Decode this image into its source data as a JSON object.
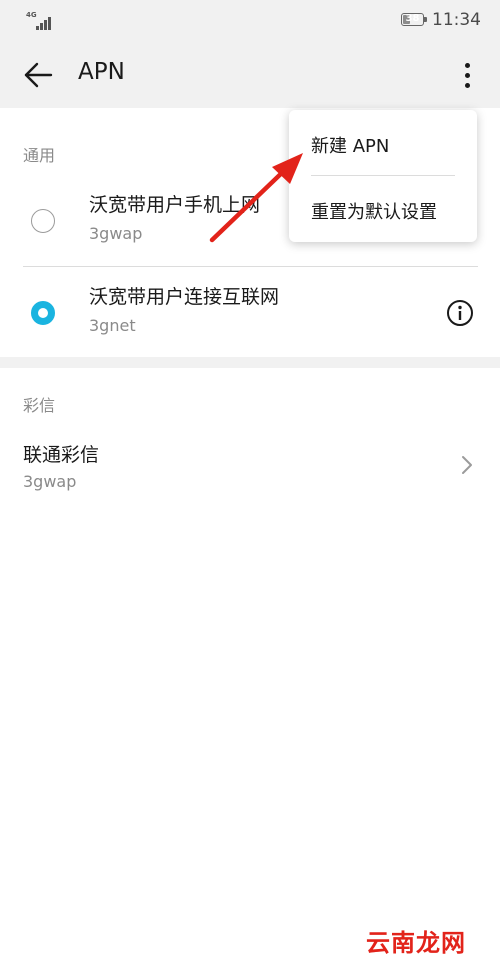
{
  "status_bar": {
    "network_type": "4G",
    "battery_level": "38",
    "battery_fraction": 0.38,
    "time": "11:34"
  },
  "app_bar": {
    "title": "APN",
    "back_icon": "arrow-left-icon",
    "more_icon": "more-vertical-icon"
  },
  "sections": {
    "general": {
      "header": "通用",
      "items": [
        {
          "title": "沃宽带用户手机上网",
          "subtitle": "3gwap",
          "selected": false
        },
        {
          "title": "沃宽带用户连接互联网",
          "subtitle": "3gnet",
          "selected": true
        }
      ]
    },
    "mms": {
      "header": "彩信",
      "items": [
        {
          "title": "联通彩信",
          "subtitle": "3gwap"
        }
      ]
    }
  },
  "menu": {
    "items": [
      {
        "label": "新建 APN"
      },
      {
        "label": "重置为默认设置"
      }
    ]
  },
  "watermark": "云南龙网",
  "colors": {
    "accent": "#1ab4e0",
    "annotation_arrow": "#e2231a",
    "watermark": "#e2231a",
    "bar_background": "#f1f1f1"
  }
}
